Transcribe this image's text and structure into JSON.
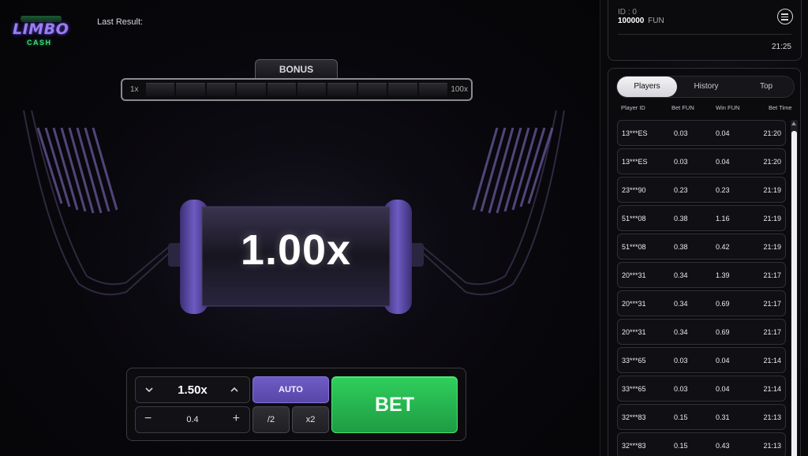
{
  "logo": {
    "line1": "LIMBO",
    "line2": "CASH"
  },
  "header": {
    "last_result_label": "Last Result:"
  },
  "bonus": {
    "tab_label": "BONUS",
    "min_label": "1x",
    "max_label": "100x",
    "segments": 10
  },
  "game": {
    "multiplier": "1.00x"
  },
  "bet_panel": {
    "target_odds": "1.50x",
    "bet_amount": "0.4",
    "auto_label": "AUTO",
    "half_label": "/2",
    "double_label": "x2",
    "bet_label": "BET",
    "minus": "−",
    "plus": "+"
  },
  "user": {
    "id_label": "ID : 0",
    "balance": "100000",
    "currency": "FUN",
    "time": "21:25"
  },
  "bets_panel": {
    "tabs": [
      "Players",
      "History",
      "Top"
    ],
    "active_tab": "Players",
    "columns": [
      "Player ID",
      "Bet  FUN",
      "Win  FUN",
      "Bet Time"
    ],
    "rows": [
      {
        "player": "13***ES",
        "bet": "0.03",
        "win": "0.04",
        "time": "21:20"
      },
      {
        "player": "13***ES",
        "bet": "0.03",
        "win": "0.04",
        "time": "21:20"
      },
      {
        "player": "23***90",
        "bet": "0.23",
        "win": "0.23",
        "time": "21:19"
      },
      {
        "player": "51***08",
        "bet": "0.38",
        "win": "1.16",
        "time": "21:19"
      },
      {
        "player": "51***08",
        "bet": "0.38",
        "win": "0.42",
        "time": "21:19"
      },
      {
        "player": "20***31",
        "bet": "0.34",
        "win": "1.39",
        "time": "21:17"
      },
      {
        "player": "20***31",
        "bet": "0.34",
        "win": "0.69",
        "time": "21:17"
      },
      {
        "player": "20***31",
        "bet": "0.34",
        "win": "0.69",
        "time": "21:17"
      },
      {
        "player": "33***65",
        "bet": "0.03",
        "win": "0.04",
        "time": "21:14"
      },
      {
        "player": "33***65",
        "bet": "0.03",
        "win": "0.04",
        "time": "21:14"
      },
      {
        "player": "32***83",
        "bet": "0.15",
        "win": "0.31",
        "time": "21:13"
      },
      {
        "player": "32***83",
        "bet": "0.15",
        "win": "0.43",
        "time": "21:13"
      }
    ]
  },
  "colors": {
    "accent_purple": "#6f5cc6",
    "bet_green": "#2fcf5d",
    "background": "#060608"
  }
}
